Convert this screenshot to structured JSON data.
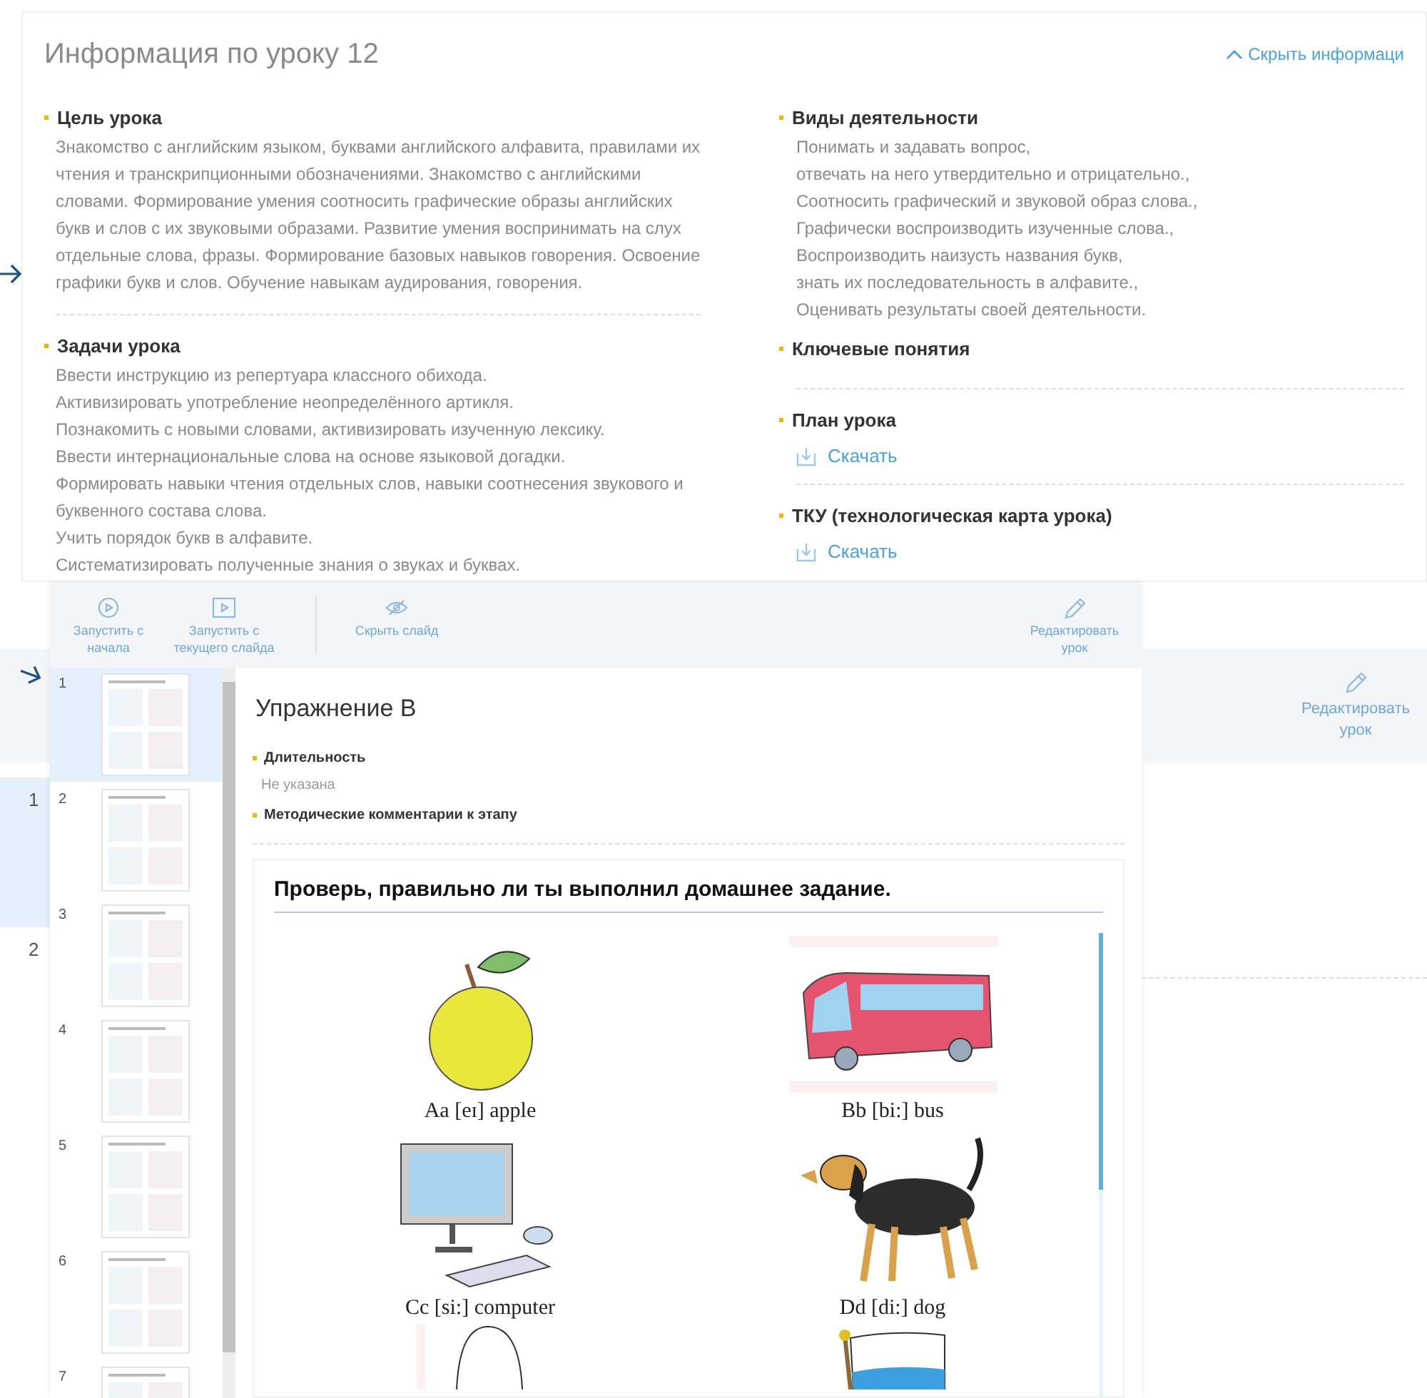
{
  "info": {
    "title": "Информация по уроку 12",
    "hide_link": "Скрыть информаци",
    "goal": {
      "heading": "Цель урока",
      "text": "Знакомство с английским языком, буквами английского алфавита, правилами их чтения и транскрипционными обозначениями. Знакомство с английскими словами. Формирование умения соотносить графические образы английских букв и слов с их звуковыми образами. Развитие умения воспринимать на слух отдельные слова, фразы. Формирование базовых навыков говорения. Освоение графики букв и слов. Обучение навыкам аудирования, говорения."
    },
    "tasks": {
      "heading": "Задачи урока",
      "lines": [
        "Ввести инструкцию из репертуара классного обихода.",
        "Активизировать употребление неопределённого артикля.",
        "Познакомить с новыми словами, активизировать изученную лексику.",
        "Ввести интернациональные слова на основе языковой догадки.",
        "Формировать навыки чтения отдельных слов, навыки соотнесения звукового и буквенного состава слова.",
        "Учить порядок букв в алфавите.",
        "Систематизировать полученные знания о звуках и буквах."
      ]
    },
    "activities": {
      "heading": "Виды деятельности",
      "lines": [
        "Понимать и задавать вопрос,",
        "отвечать на него утвердительно и отрицательно.,",
        "Соотносить графический и звуковой образ слова.,",
        "Графически воспроизводить изученные слова.,",
        "Воспроизводить наизусть названия букв,",
        "знать их последовательность в алфавите.,",
        "Оценивать результаты своей деятельности."
      ]
    },
    "key_concepts": {
      "heading": "Ключевые понятия"
    },
    "plan": {
      "heading": "План урока",
      "download": "Скачать"
    },
    "tku": {
      "heading": "ТКУ (технологическая карта урока)",
      "download": "Скачать"
    }
  },
  "lesson_stages": [
    {
      "number": "1",
      "selected": true
    },
    {
      "number": "2",
      "selected": false
    }
  ],
  "edit_button": "Редактировать урок",
  "viewer": {
    "toolbar": [
      {
        "kind": "play",
        "label": "Запустить с начала"
      },
      {
        "kind": "play-slide",
        "label": "Запустить с текущего слайда"
      },
      {
        "kind": "hide",
        "label": "Скрыть слайд"
      }
    ],
    "edit_button": "Редактировать урок",
    "slides": [
      {
        "number": "1",
        "selected": true
      },
      {
        "number": "2",
        "selected": false
      },
      {
        "number": "3",
        "selected": false
      },
      {
        "number": "4",
        "selected": false
      },
      {
        "number": "5",
        "selected": false
      },
      {
        "number": "6",
        "selected": false
      },
      {
        "number": "7",
        "selected": false
      }
    ],
    "stage": {
      "title": "Упражнение В",
      "duration_label": "Длительность",
      "duration_value": "Не указана",
      "comments_label": "Методические комментарии к этапу"
    },
    "slide": {
      "heading": "Проверь, правильно ли ты выполнил домашнее задание.",
      "cards": [
        {
          "kind": "apple",
          "caption": "Aa [eɪ] apple"
        },
        {
          "kind": "bus",
          "caption": "Bb [bi:] bus"
        },
        {
          "kind": "computer",
          "caption": "Cc [si:] computer"
        },
        {
          "kind": "dog",
          "caption": "Dd [di:] dog"
        },
        {
          "kind": "egg"
        },
        {
          "kind": "flag"
        }
      ]
    }
  }
}
